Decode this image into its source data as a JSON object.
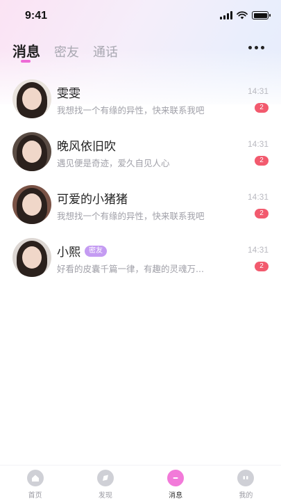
{
  "status_bar": {
    "time": "9:41"
  },
  "tabs": [
    {
      "label": "消息",
      "active": true
    },
    {
      "label": "密友",
      "active": false
    },
    {
      "label": "通话",
      "active": false
    }
  ],
  "conversations": [
    {
      "name": "雯雯",
      "preview": "我想找一个有缘的异性，快来联系我吧",
      "time": "14:31",
      "unread": "2",
      "badge": ""
    },
    {
      "name": "晚风依旧吹",
      "preview": "遇见便是奇迹，爱久自见人心",
      "time": "14:31",
      "unread": "2",
      "badge": ""
    },
    {
      "name": "可爱的小猪猪",
      "preview": "我想找一个有缘的异性，快来联系我吧",
      "time": "14:31",
      "unread": "2",
      "badge": ""
    },
    {
      "name": "小熙",
      "preview": "好看的皮囊千篇一律，有趣的灵魂万...",
      "time": "14:31",
      "unread": "2",
      "badge": "密友"
    }
  ],
  "bottom_nav": [
    {
      "label": "首页",
      "icon": "home-icon",
      "active": false
    },
    {
      "label": "发现",
      "icon": "discover-icon",
      "active": false
    },
    {
      "label": "消息",
      "icon": "message-icon",
      "active": true
    },
    {
      "label": "我的",
      "icon": "profile-icon",
      "active": false
    }
  ],
  "colors": {
    "accent": "#f27ad9",
    "unread_badge": "#f25a6e",
    "friend_badge": "#c49bf2"
  }
}
